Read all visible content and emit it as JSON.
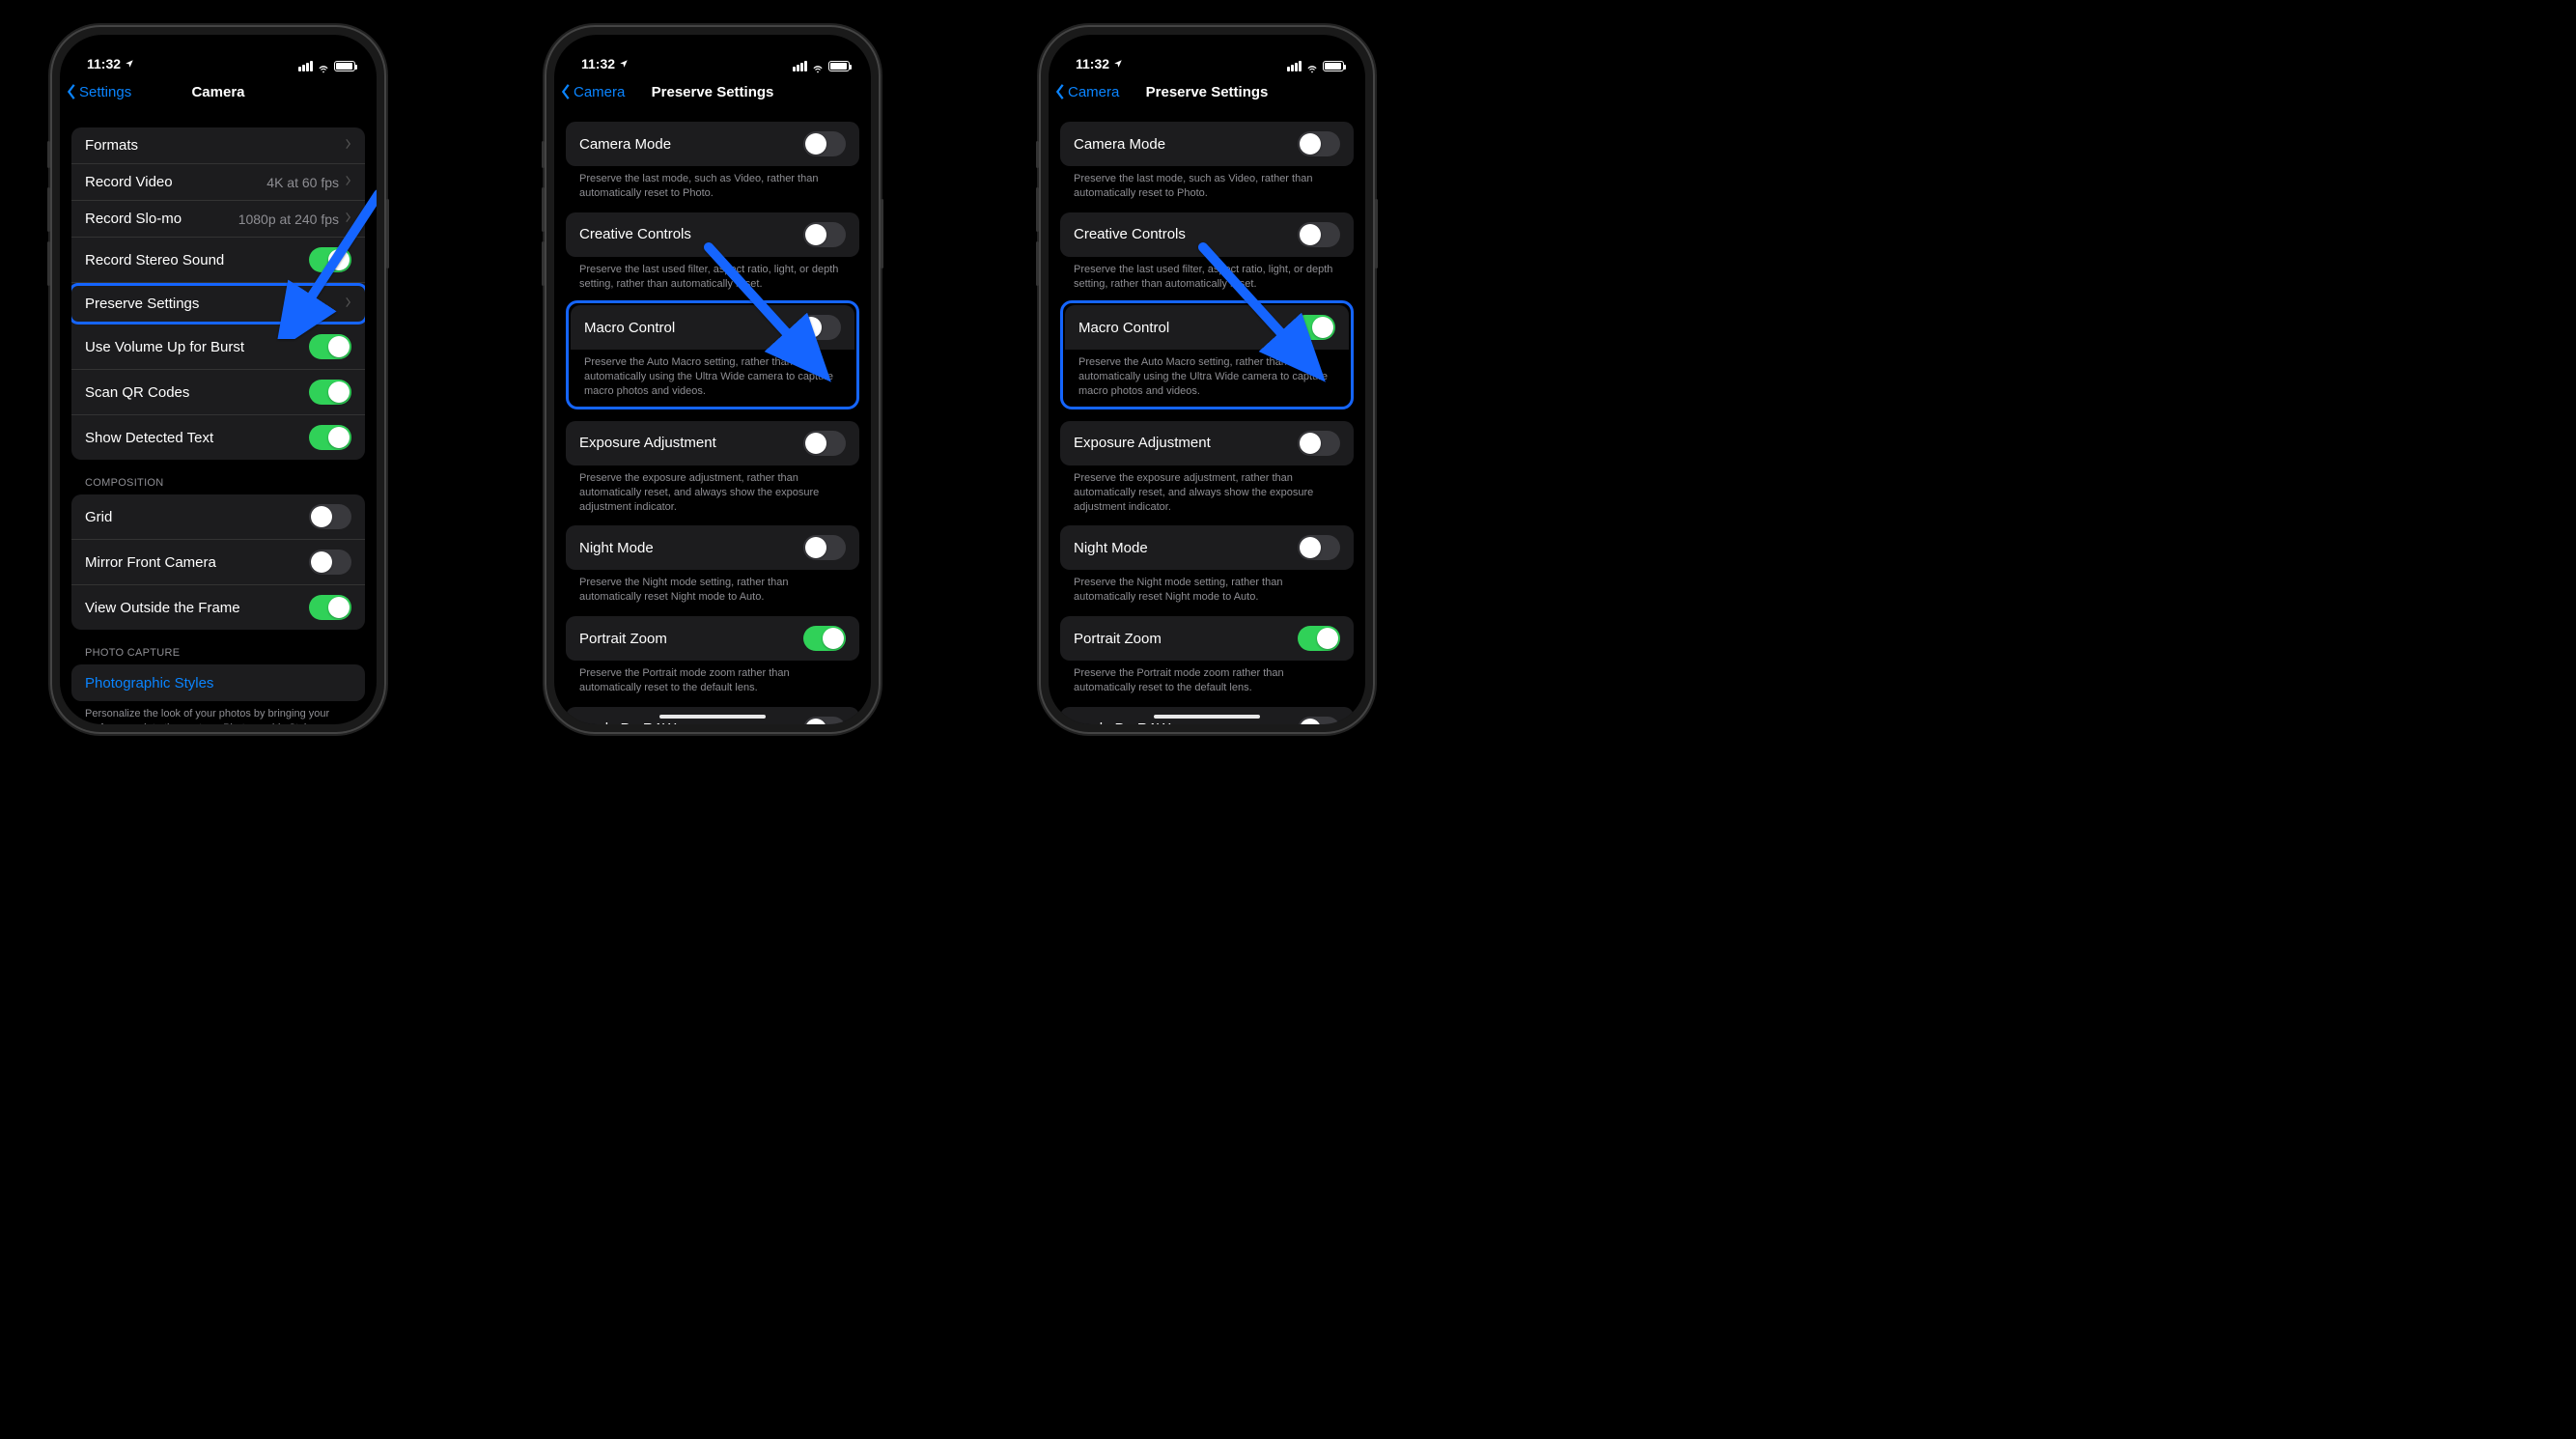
{
  "status": {
    "time": "11:32"
  },
  "phone1": {
    "back": "Settings",
    "title": "Camera",
    "rows": {
      "formats": "Formats",
      "record_video": "Record Video",
      "record_video_detail": "4K at 60 fps",
      "record_slomo": "Record Slo-mo",
      "record_slomo_detail": "1080p at 240 fps",
      "stereo": "Record Stereo Sound",
      "preserve": "Preserve Settings",
      "volume_burst": "Use Volume Up for Burst",
      "qr": "Scan QR Codes",
      "detected_text": "Show Detected Text"
    },
    "composition_header": "COMPOSITION",
    "composition": {
      "grid": "Grid",
      "mirror": "Mirror Front Camera",
      "outside_frame": "View Outside the Frame"
    },
    "photo_capture_header": "PHOTO CAPTURE",
    "photo_capture": {
      "styles": "Photographic Styles",
      "styles_footer": "Personalize the look of your photos by bringing your preferences into the capture. Photographic Styles use advanced scene understanding to apply the right amount of adjustments to different parts of the"
    }
  },
  "phone2": {
    "back": "Camera",
    "title": "Preserve Settings",
    "items": {
      "camera_mode": {
        "label": "Camera Mode",
        "footer": "Preserve the last mode, such as Video, rather than automatically reset to Photo.",
        "on": false
      },
      "creative": {
        "label": "Creative Controls",
        "footer": "Preserve the last used filter, aspect ratio, light, or depth setting, rather than automatically reset.",
        "on": false
      },
      "macro": {
        "label": "Macro Control",
        "footer": "Preserve the Auto Macro setting, rather than automatically using the Ultra Wide camera to capture macro photos and videos.",
        "on": false
      },
      "exposure": {
        "label": "Exposure Adjustment",
        "footer": "Preserve the exposure adjustment, rather than automatically reset, and always show the exposure adjustment indicator.",
        "on": false
      },
      "night": {
        "label": "Night Mode",
        "footer": "Preserve the Night mode setting, rather than automatically reset Night mode to Auto.",
        "on": false
      },
      "portrait": {
        "label": "Portrait Zoom",
        "footer": "Preserve the Portrait mode zoom rather than automatically reset to the default lens.",
        "on": true
      },
      "proraw": {
        "label": "Apple ProRAW",
        "on": false
      }
    }
  },
  "phone3": {
    "back": "Camera",
    "title": "Preserve Settings",
    "items": {
      "camera_mode": {
        "label": "Camera Mode",
        "footer": "Preserve the last mode, such as Video, rather than automatically reset to Photo.",
        "on": false
      },
      "creative": {
        "label": "Creative Controls",
        "footer": "Preserve the last used filter, aspect ratio, light, or depth setting, rather than automatically reset.",
        "on": false
      },
      "macro": {
        "label": "Macro Control",
        "footer": "Preserve the Auto Macro setting, rather than automatically using the Ultra Wide camera to capture macro photos and videos.",
        "on": true
      },
      "exposure": {
        "label": "Exposure Adjustment",
        "footer": "Preserve the exposure adjustment, rather than automatically reset, and always show the exposure adjustment indicator.",
        "on": false
      },
      "night": {
        "label": "Night Mode",
        "footer": "Preserve the Night mode setting, rather than automatically reset Night mode to Auto.",
        "on": false
      },
      "portrait": {
        "label": "Portrait Zoom",
        "footer": "Preserve the Portrait mode zoom rather than automatically reset to the default lens.",
        "on": true
      },
      "proraw": {
        "label": "Apple ProRAW",
        "on": false
      }
    }
  }
}
